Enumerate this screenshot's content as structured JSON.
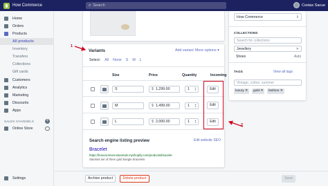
{
  "topbar": {
    "store_name": "How Commerce",
    "search_placeholder": "Search",
    "user_name": "Costas Sacue"
  },
  "sidebar": {
    "items": [
      {
        "label": "Home",
        "icon": "home-icon"
      },
      {
        "label": "Orders",
        "icon": "orders-icon"
      },
      {
        "label": "Products",
        "icon": "products-icon"
      },
      {
        "label": "All products"
      },
      {
        "label": "Inventory"
      },
      {
        "label": "Transfers"
      },
      {
        "label": "Collections"
      },
      {
        "label": "Gift cards"
      },
      {
        "label": "Customers",
        "icon": "customers-icon"
      },
      {
        "label": "Analytics",
        "icon": "analytics-icon"
      },
      {
        "label": "Marketing",
        "icon": "marketing-icon"
      },
      {
        "label": "Discounts",
        "icon": "discounts-icon"
      },
      {
        "label": "Apps",
        "icon": "apps-icon"
      }
    ],
    "sales_channels_label": "SALES CHANNELS",
    "online_store": "Online Store",
    "settings": "Settings"
  },
  "annotations": {
    "arrow1": "1",
    "arrow2": "2",
    "arrow_color": "#d0021b"
  },
  "variants": {
    "title": "Variants",
    "add_variant": "Add variant",
    "more_options": "More options ▾",
    "select_label": "Select:",
    "select_options": [
      "All",
      "None",
      "S",
      "M",
      "L"
    ],
    "columns": {
      "size": "Size",
      "price": "Price",
      "quantity": "Quantity",
      "incoming": "Incoming"
    },
    "rows": [
      {
        "size": "S",
        "currency": "$",
        "price": "1,299.00",
        "quantity": "1",
        "edit": "Edit"
      },
      {
        "size": "M",
        "currency": "$",
        "price": "1,499.00",
        "quantity": "1",
        "edit": "Edit"
      },
      {
        "size": "L",
        "currency": "$",
        "price": "2,000.00",
        "quantity": "1",
        "edit": "Edit"
      }
    ]
  },
  "seo": {
    "title": "Search engine listing preview",
    "edit_link": "Edit website SEO",
    "page_title": "Bracelet",
    "url": "https://howcommercetutorials.myshopify.com/products/bracelet",
    "description": "Stacked set of three gold bangle bracelets"
  },
  "footer": {
    "archive": "Archive product",
    "delete": "Delete product",
    "save": "Save"
  },
  "right_panel": {
    "store_select": "How Commerce",
    "collections_label": "COLLECTIONS",
    "collections_placeholder": "Search for collections",
    "collection_value": "Jewellery",
    "shoes": "Shoes",
    "auto": "Auto",
    "tags_label": "TAGS",
    "view_all_tags": "View all tags",
    "tags_placeholder": "Vintage, cotton, summer",
    "tags": [
      "luxury",
      "gold",
      "fashion"
    ]
  }
}
